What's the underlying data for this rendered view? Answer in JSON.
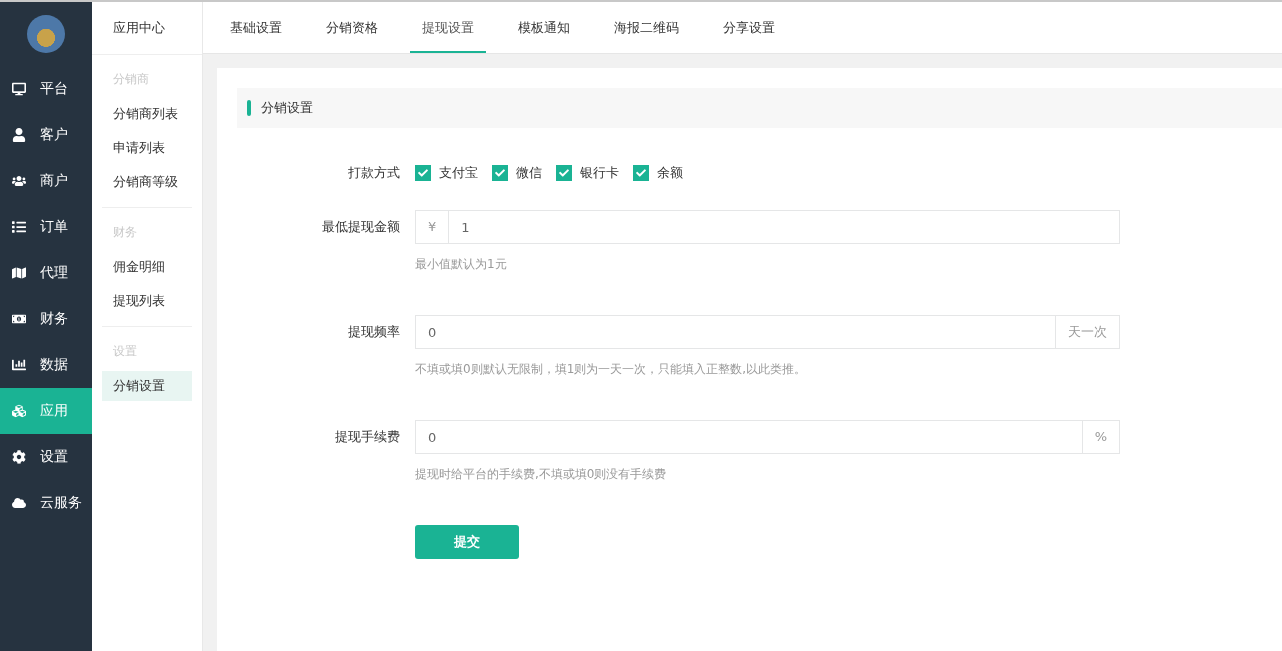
{
  "nav": [
    {
      "label": "平台",
      "selected": false
    },
    {
      "label": "客户",
      "selected": false
    },
    {
      "label": "商户",
      "selected": false
    },
    {
      "label": "订单",
      "selected": false
    },
    {
      "label": "代理",
      "selected": false
    },
    {
      "label": "财务",
      "selected": false
    },
    {
      "label": "数据",
      "selected": false
    },
    {
      "label": "应用",
      "selected": true
    },
    {
      "label": "设置",
      "selected": false
    },
    {
      "label": "云服务",
      "selected": false
    }
  ],
  "submenu": {
    "title": "应用中心",
    "groups": [
      {
        "heading": "分销商",
        "items": [
          {
            "label": "分销商列表",
            "selected": false
          },
          {
            "label": "申请列表",
            "selected": false
          },
          {
            "label": "分销商等级",
            "selected": false
          }
        ]
      },
      {
        "heading": "财务",
        "items": [
          {
            "label": "佣金明细",
            "selected": false
          },
          {
            "label": "提现列表",
            "selected": false
          }
        ]
      },
      {
        "heading": "设置",
        "items": [
          {
            "label": "分销设置",
            "selected": true
          }
        ]
      }
    ]
  },
  "tabs": [
    {
      "label": "基础设置",
      "selected": false
    },
    {
      "label": "分销资格",
      "selected": false
    },
    {
      "label": "提现设置",
      "selected": true
    },
    {
      "label": "模板通知",
      "selected": false
    },
    {
      "label": "海报二维码",
      "selected": false
    },
    {
      "label": "分享设置",
      "selected": false
    }
  ],
  "section_title": "分销设置",
  "form": [
    {
      "kind": "checkboxes",
      "label": "打款方式",
      "options": [
        {
          "label": "支付宝",
          "checked": true
        },
        {
          "label": "微信",
          "checked": true
        },
        {
          "label": "银行卡",
          "checked": true
        },
        {
          "label": "余额",
          "checked": true
        }
      ]
    },
    {
      "kind": "input",
      "label": "最低提现金额",
      "prefix": "¥",
      "value": "1",
      "hint": "最小值默认为1元"
    },
    {
      "kind": "input",
      "label": "提现频率",
      "value": "0",
      "suffix": "天一次",
      "hint": "不填或填0则默认无限制，填1则为一天一次，只能填入正整数,以此类推。"
    },
    {
      "kind": "input",
      "label": "提现手续费",
      "value": "0",
      "suffix": "%",
      "hint": "提现时给平台的手续费,不填或填0则没有手续费"
    }
  ],
  "submit": "提交"
}
